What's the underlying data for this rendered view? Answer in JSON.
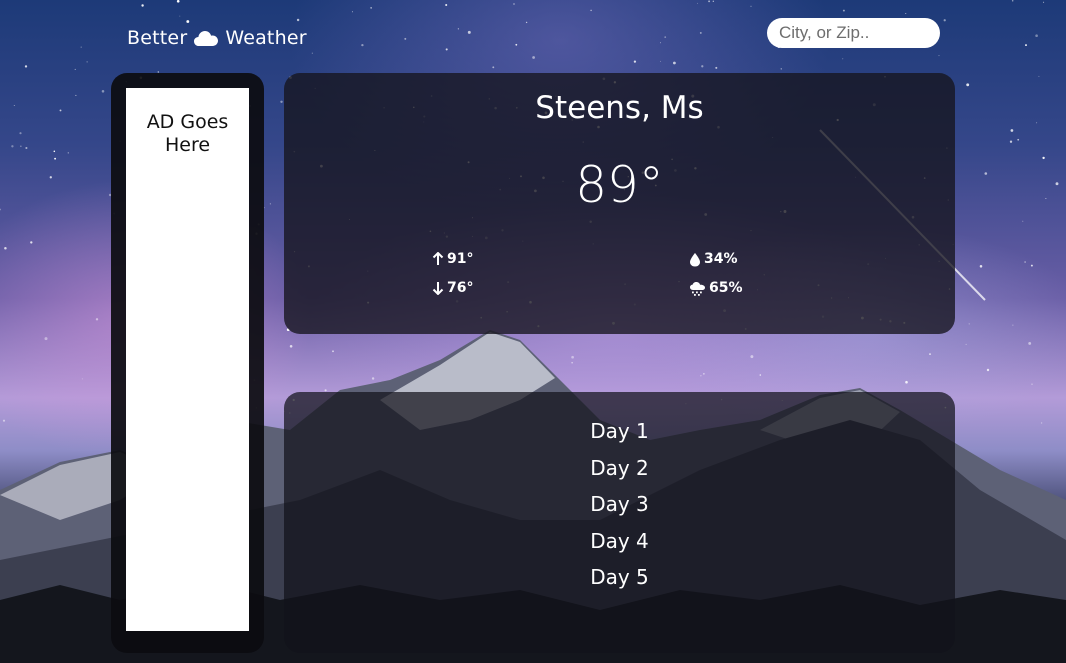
{
  "header": {
    "logo_left": "Better",
    "logo_icon": "cloud-icon",
    "logo_right": "Weather"
  },
  "search": {
    "placeholder": "City, or Zip..",
    "value": ""
  },
  "ad": {
    "text": "AD Goes Here"
  },
  "current": {
    "city": "Steens, Ms",
    "temperature": "89°",
    "high": {
      "icon": "arrow-up-icon",
      "value": "91°"
    },
    "low": {
      "icon": "arrow-down-icon",
      "value": "76°"
    },
    "humidity": {
      "icon": "droplet-icon",
      "value": "34%"
    },
    "precipitation": {
      "icon": "rain-cloud-icon",
      "value": "65%"
    }
  },
  "forecast": {
    "days": [
      "Day 1",
      "Day 2",
      "Day 3",
      "Day 4",
      "Day 5"
    ]
  },
  "colors": {
    "card_background": "#16141e",
    "text": "#ffffff",
    "search_background": "#ffffff"
  }
}
